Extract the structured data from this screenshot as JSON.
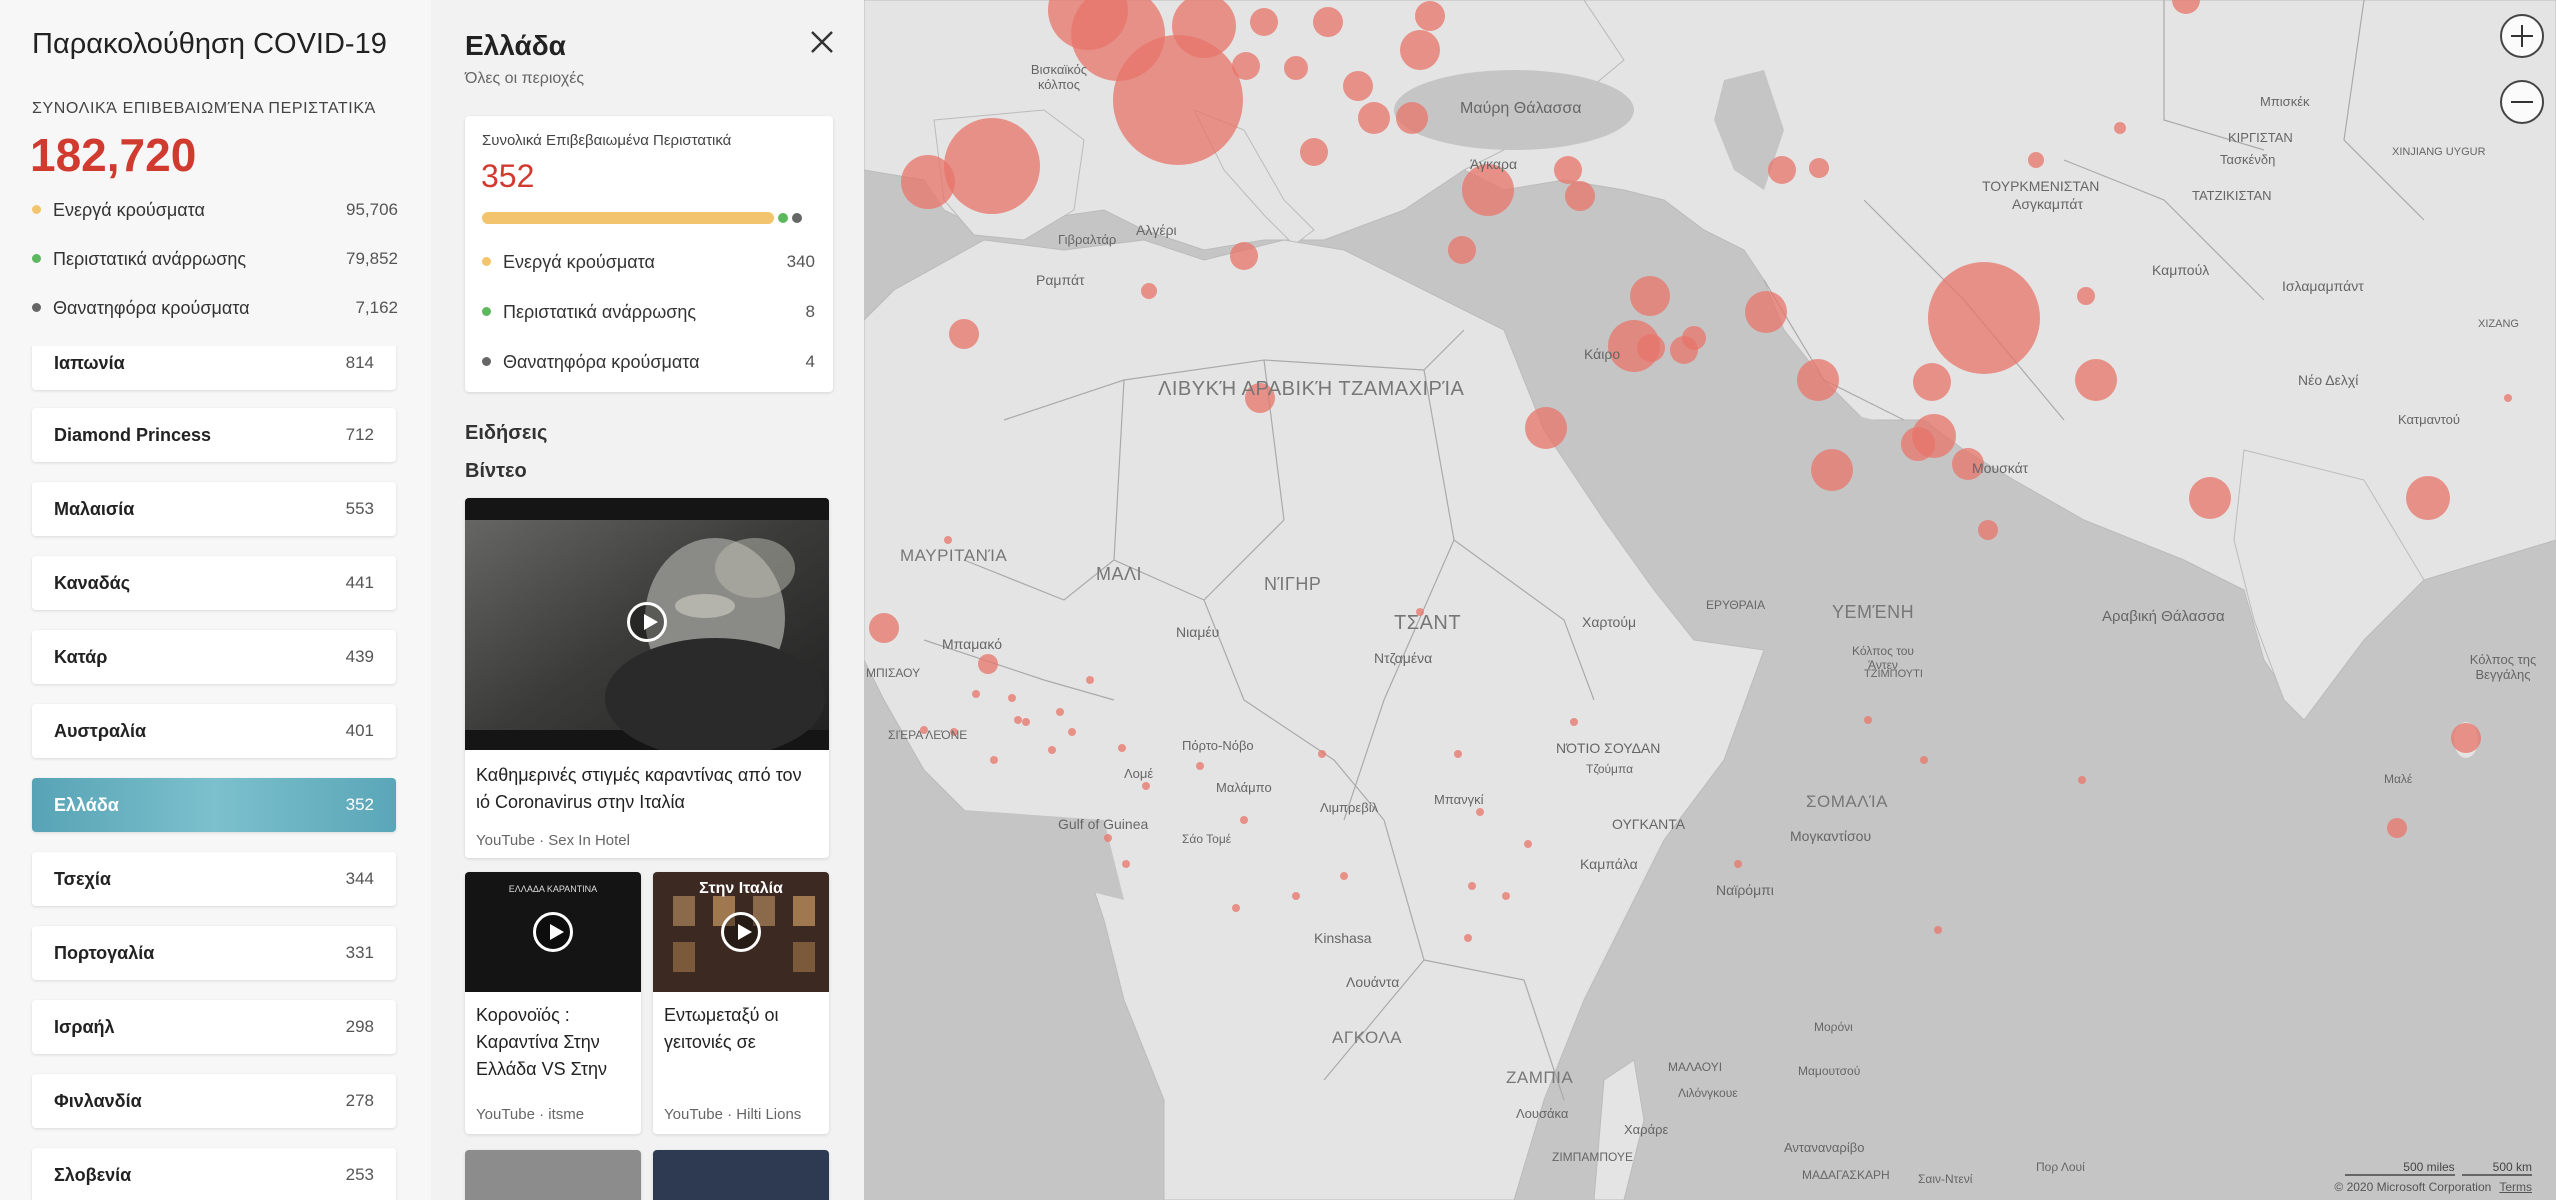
{
  "sidebar": {
    "title": "Παρακολούθηση COVID-19",
    "total_label": "ΣΥΝΟΛΙΚΆ ΕΠΙΒΕΒΑΙΩΜΈΝΑ ΠΕΡΙΣΤΑΤΙΚΆ",
    "total_value": "182,720",
    "stats": [
      {
        "label": "Ενεργά κρούσματα",
        "value": "95,706",
        "color": "#f2c46d"
      },
      {
        "label": "Περιστατικά ανάρρωσης",
        "value": "79,852",
        "color": "#5cb85c"
      },
      {
        "label": "Θανατηφόρα κρούσματα",
        "value": "7,162",
        "color": "#666666"
      }
    ],
    "countries": [
      {
        "name": "Ιαπωνία",
        "value": "814"
      },
      {
        "name": "Diamond Princess",
        "value": "712"
      },
      {
        "name": "Μαλαισία",
        "value": "553"
      },
      {
        "name": "Καναδάς",
        "value": "441"
      },
      {
        "name": "Κατάρ",
        "value": "439"
      },
      {
        "name": "Αυστραλία",
        "value": "401"
      },
      {
        "name": "Ελλάδα",
        "value": "352"
      },
      {
        "name": "Τσεχία",
        "value": "344"
      },
      {
        "name": "Πορτογαλία",
        "value": "331"
      },
      {
        "name": "Ισραήλ",
        "value": "298"
      },
      {
        "name": "Φινλανδία",
        "value": "278"
      },
      {
        "name": "Σλοβενία",
        "value": "253"
      }
    ],
    "selected_country": "Ελλάδα",
    "selected_color": "#5aa6b8"
  },
  "detail": {
    "title": "Ελλάδα",
    "subtitle": "Όλες οι περιοχές",
    "card_label": "Συνολικά Επιβεβαιωμένα Περιστατικά",
    "card_value": "352",
    "active_fraction": 0.966,
    "stats": [
      {
        "label": "Ενεργά κρούσματα",
        "value": "340",
        "color": "#f2c46d"
      },
      {
        "label": "Περιστατικά ανάρρωσης",
        "value": "8",
        "color": "#5cb85c"
      },
      {
        "label": "Θανατηφόρα κρούσματα",
        "value": "4",
        "color": "#666666"
      }
    ],
    "news_heading": "Ειδήσεις",
    "video_heading": "Βίντεο",
    "videos": [
      {
        "title": "Καθημερινές στιγμές καραντίνας από τον ιό Coronavirus στην Ιταλία",
        "source": "YouTube · Sex In Hotel"
      },
      {
        "title": "Κορονοϊός : Καραντίνα Στην Ελλάδα VS Στην Ιταλία",
        "source": "YouTube · itsme",
        "thumb_text": "ΕΛΛΑΔΑ ΚΑΡΑΝΤΙΝΑ"
      },
      {
        "title": "Εντωμεταξύ οι γειτονιές σε Ελλάδα και Ιταλία",
        "source": "YouTube · Hilti Lions",
        "thumb_text": "Στην Ιταλία"
      }
    ]
  },
  "map": {
    "zoom_in_icon": "plus-icon",
    "zoom_out_icon": "minus-icon",
    "case_color": "#e8746a",
    "labels": {
      "libya": "ΛΙΒΥΚΉ ΑΡΑΒΙΚΉ ΤΖΑΜΑΧΙΡΊΑ",
      "chad": "ΤΣΑΝΤ",
      "mali": "ΜΑΛΙ",
      "niger": "ΝΊΓΗΡ",
      "mauritania": "ΜΑΥΡΙΤΑΝΊΑ",
      "yemen": "ΥΕΜΈΝΗ",
      "somalia": "ΣΟΜΑΛΊΑ",
      "angola": "ΑΓΚΟΛΑ",
      "zambia": "ΖΑΜΠΙΑ",
      "black_sea": "Μαύρη Θάλασσα",
      "arabian_sea": "Αραβική Θάλασσα",
      "ankara": "Άγκαρα",
      "cairo": "Κάιρο",
      "khartoum": "Χαρτούμ",
      "niamey": "Νιαμέυ",
      "ndjamena": "Ντζαμένα",
      "bamako": "Μπαμακό",
      "rabat": "Ραμπάτ",
      "algiers": "Αλγέρι",
      "gibraltar": "Γιβραλτάρ",
      "kinshasa": "Kinshasa",
      "luanda": "Λουάντα",
      "nairobi": "Ναϊρόμπι",
      "mogadishu": "Μογκαντίσου",
      "kampala": "Καμπάλα",
      "uganda": "ΟΥΓΚΑΝΤΑ",
      "south_sudan": "ΝΌΤΙΟ ΣΟΥΔΑΝ",
      "eritrea": "ΕΡΥΘΡΑΙΑ",
      "turkmenistan": "ΤΟΥΡΚΜΕΝΙΣΤΑΝ",
      "ashgabat": "Ασγκαμπάτ",
      "tajikistan": "ΤΑΤΖΙΚΙΣΤΑΝ",
      "kyrgyzstan": "ΚΙΡΓΙΣΤΑΝ",
      "tashkent": "Τασκένδη",
      "bishkek": "Μπισκέκ",
      "xinjiang": "XINJIANG UYGUR",
      "kabul": "Καμπούλ",
      "islamabad": "Ισλαμαμπάντ",
      "new_delhi": "Νέο Δελχί",
      "muscat": "Μουσκάτ",
      "bay_of_bengal": "Κόλπος της Βεγγάλης",
      "gulf_of_aden": "Κόλπος του Άντεν",
      "gulf_of_guinea": "Gulf of Guinea",
      "biscay": "Βισκαϊκός κόλπος",
      "sierra_leone": "ΣΙΈΡΑ ΛΕΌΝΕ",
      "porto_novo": "Πόρτο-Νόβο",
      "lome": "Λομέ",
      "malabo": "Μαλάμπο",
      "sao_tome": "Σάο Τομέ",
      "gabon_city": "Λιμπρεβίλ",
      "moroni": "Μορόνι",
      "lilongwe": "Λιλόνγκουε",
      "lusaka": "Λουσάκα",
      "harare": "Χαράρε",
      "antananarivo": "Ανταναναρίβο",
      "madagascar": "ΜΑΔΑΓΑΣΚΑΡΗ",
      "zimbabwe": "ΖΙΜΠΑΜΠΟΥΕ",
      "malawi": "ΜΑΛΑΟΥΙ",
      "djibouti": "ΤΖΙΜΠΟΥΤΙ",
      "male": "Μαλέ",
      "port_louis": "Πορ Λουί",
      "saint_denis": "Σαιν-Ντενί",
      "mamoudzou": "Μαμουτσού",
      "katmandu": "Κατμαντού",
      "xizang": "XIZANG",
      "mbandaka": "Μπανγκί",
      "djuba": "Τζούμπα",
      "dakar": "ΜΠΙΣΑΟΥ",
      "mpouza": "Μπαμακό"
    },
    "scale_miles": "500 miles",
    "scale_km": "500 km",
    "copyright": "© 2020 Microsoft Corporation",
    "terms": "Terms"
  }
}
